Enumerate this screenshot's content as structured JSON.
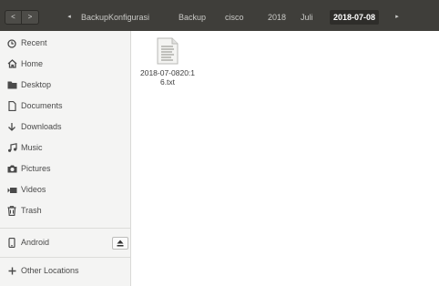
{
  "header": {
    "back_label": "<",
    "forward_label": ">",
    "left_arrow": "◂",
    "right_arrow": "▸",
    "breadcrumbs": [
      "BackupKonfigurasi",
      "Backup",
      "cisco",
      "2018",
      "Juli",
      "2018-07-08"
    ]
  },
  "sidebar": {
    "items": [
      {
        "label": "Recent",
        "icon": "clock-icon"
      },
      {
        "label": "Home",
        "icon": "home-icon"
      },
      {
        "label": "Desktop",
        "icon": "folder-icon"
      },
      {
        "label": "Documents",
        "icon": "document-icon"
      },
      {
        "label": "Downloads",
        "icon": "download-icon"
      },
      {
        "label": "Music",
        "icon": "music-icon"
      },
      {
        "label": "Pictures",
        "icon": "camera-icon"
      },
      {
        "label": "Videos",
        "icon": "video-icon"
      },
      {
        "label": "Trash",
        "icon": "trash-icon"
      }
    ],
    "devices": [
      {
        "label": "Android",
        "icon": "phone-icon",
        "eject_icon": "eject-icon"
      }
    ],
    "other": {
      "label": "Other Locations",
      "icon": "plus-icon"
    }
  },
  "files": [
    {
      "name": "2018-07-0820:16.txt",
      "icon": "text-file-icon"
    }
  ],
  "colors": {
    "header_bg": "#3f3e3a",
    "active_crumb": "#2e2d2a",
    "sidebar_bg": "#f4f4f3"
  }
}
